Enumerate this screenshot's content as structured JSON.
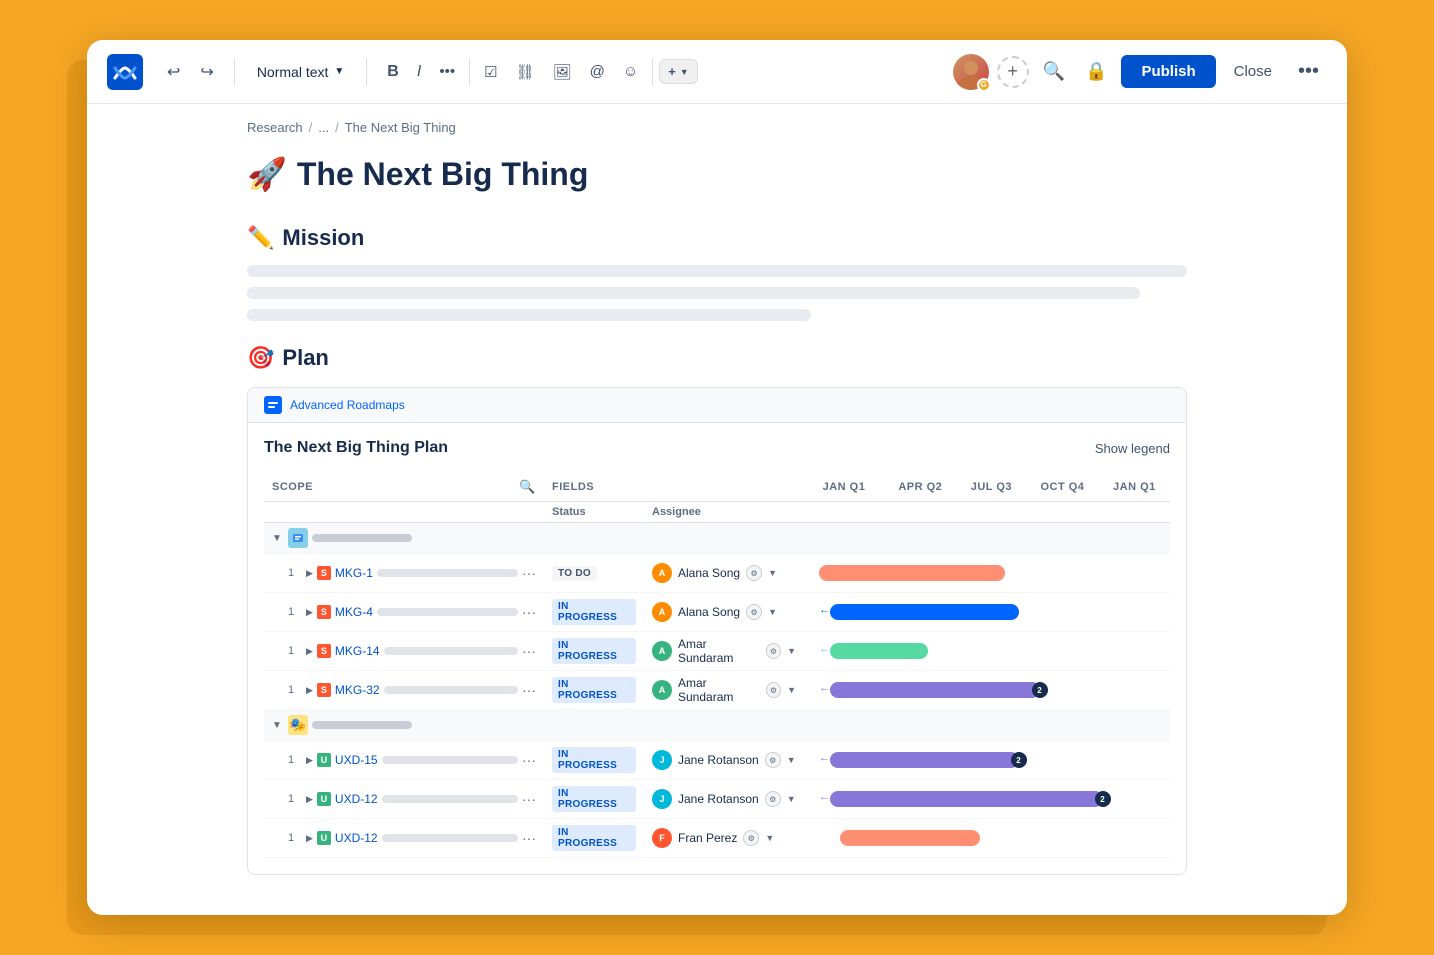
{
  "toolbar": {
    "logo_alt": "Confluence logo",
    "undo_label": "Undo",
    "redo_label": "Redo",
    "text_style_label": "Normal text",
    "bold_label": "B",
    "italic_label": "I",
    "more_label": "...",
    "checkbox_label": "☑",
    "link_label": "🔗",
    "image_label": "🖼",
    "mention_label": "@",
    "emoji_label": "😊",
    "insert_label": "+",
    "publish_label": "Publish",
    "close_label": "Close",
    "more_options_label": "•••",
    "search_label": "Search",
    "lock_label": "🔒"
  },
  "breadcrumb": {
    "parts": [
      "Research",
      "/",
      "...",
      "/",
      "The Next Big Thing"
    ]
  },
  "page": {
    "title_emoji": "🚀",
    "title": "The Next Big Thing",
    "mission_emoji": "✏️",
    "mission_label": "Mission",
    "plan_emoji": "🎯",
    "plan_label": "Plan"
  },
  "widget": {
    "header_label": "Advanced Roadmaps",
    "title": "The Next Big Thing Plan",
    "show_legend_label": "Show legend",
    "columns": {
      "scope": "SCOPE",
      "fields": "FIELDS",
      "status": "Status",
      "assignee": "Assignee",
      "quarters": [
        "Jan Q1",
        "Apr Q2",
        "Jul Q3",
        "Oct Q4",
        "Jan Q1"
      ]
    },
    "rows": [
      {
        "type": "parent",
        "indent": 0,
        "expanded": true,
        "icon_color": "#ddd",
        "id": "",
        "title_skeleton": true,
        "status": "",
        "assignee": ""
      },
      {
        "type": "issue",
        "indent": 1,
        "num": "1",
        "icon_type": "mkg",
        "id": "MKG-1",
        "status": "TO DO",
        "status_class": "status-todo",
        "assignee_name": "Alana Song",
        "assignee_color": "av-orange",
        "bar_color": "bar-pink",
        "bar_left": "0%",
        "bar_width": "55%",
        "badge": null
      },
      {
        "type": "issue",
        "indent": 1,
        "num": "1",
        "icon_type": "mkg",
        "id": "MKG-4",
        "status": "IN PROGRESS",
        "status_class": "status-inprogress",
        "assignee_name": "Alana Song",
        "assignee_color": "av-orange",
        "bar_color": "bar-blue",
        "bar_left": "0%",
        "bar_width": "55%",
        "badge": null
      },
      {
        "type": "issue",
        "indent": 1,
        "num": "1",
        "icon_type": "mkg",
        "id": "MKG-14",
        "status": "IN PROGRESS",
        "status_class": "status-inprogress",
        "assignee_name": "Amar Sundaram",
        "assignee_color": "av-green",
        "bar_color": "bar-green",
        "bar_left": "0%",
        "bar_width": "30%",
        "badge": null
      },
      {
        "type": "issue",
        "indent": 1,
        "num": "1",
        "icon_type": "mkg",
        "id": "MKG-32",
        "status": "IN PROGRESS",
        "status_class": "status-inprogress",
        "assignee_name": "Amar Sundaram",
        "assignee_color": "av-green",
        "bar_color": "bar-purple",
        "bar_left": "0%",
        "bar_width": "60%",
        "badge": "2"
      },
      {
        "type": "parent",
        "indent": 0,
        "expanded": true,
        "icon_color": "#FFB020",
        "id": "",
        "title_skeleton": true,
        "status": "",
        "assignee": ""
      },
      {
        "type": "issue",
        "indent": 1,
        "num": "1",
        "icon_type": "uxd",
        "id": "UXD-15",
        "status": "IN PROGRESS",
        "status_class": "status-inprogress",
        "assignee_name": "Jane Rotanson",
        "assignee_color": "av-blue",
        "bar_color": "bar-purple",
        "bar_left": "0%",
        "bar_width": "57%",
        "badge": "2"
      },
      {
        "type": "issue",
        "indent": 1,
        "num": "1",
        "icon_type": "uxd",
        "id": "UXD-12",
        "status": "IN PROGRESS",
        "status_class": "status-inprogress",
        "assignee_name": "Jane Rotanson",
        "assignee_color": "av-blue",
        "bar_color": "bar-purple",
        "bar_left": "0%",
        "bar_width": "80%",
        "badge": "2"
      },
      {
        "type": "issue",
        "indent": 1,
        "num": "1",
        "icon_type": "uxd",
        "id": "UXD-12",
        "status": "IN PROGRESS",
        "status_class": "status-inprogress",
        "assignee_name": "Fran Perez",
        "assignee_color": "av-pink",
        "bar_color": "bar-pink",
        "bar_left": "5%",
        "bar_width": "40%",
        "badge": null
      }
    ]
  }
}
